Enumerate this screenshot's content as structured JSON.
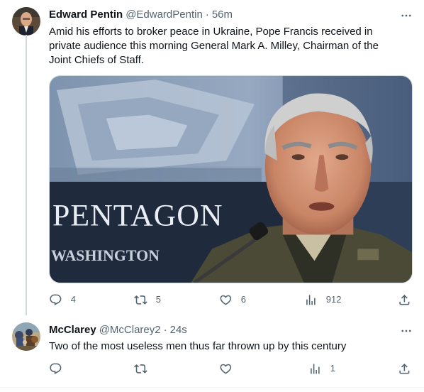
{
  "tweets": [
    {
      "author_name": "Edward Pentin",
      "author_handle": "@EdwardPentin",
      "separator": "·",
      "time": "56m",
      "text": "Amid his efforts to broker peace in Ukraine, Pope Francis received in private audience this morning General Mark A. Milley, Chairman of the Joint Chiefs of Staff.",
      "media": {
        "sign_text": "PENTAGON",
        "sign_subtext": "WASHINGTON"
      },
      "actions": {
        "reply_count": "4",
        "retweet_count": "5",
        "like_count": "6",
        "views_count": "912",
        "share_count": ""
      }
    },
    {
      "author_name": "McClarey",
      "author_handle": "@McClarey2",
      "separator": "·",
      "time": "24s",
      "text": "Two of the most useless men thus far thrown up by this century",
      "actions": {
        "reply_count": "",
        "retweet_count": "",
        "like_count": "",
        "views_count": "1",
        "share_count": ""
      }
    }
  ],
  "icons": {
    "reply": "reply-icon",
    "retweet": "retweet-icon",
    "like": "like-icon",
    "views": "views-icon",
    "share": "share-icon",
    "more": "more-icon"
  },
  "colors": {
    "text": "#0f1419",
    "secondary": "#536471",
    "border": "#cfd9de",
    "divider": "#eff3f4"
  }
}
